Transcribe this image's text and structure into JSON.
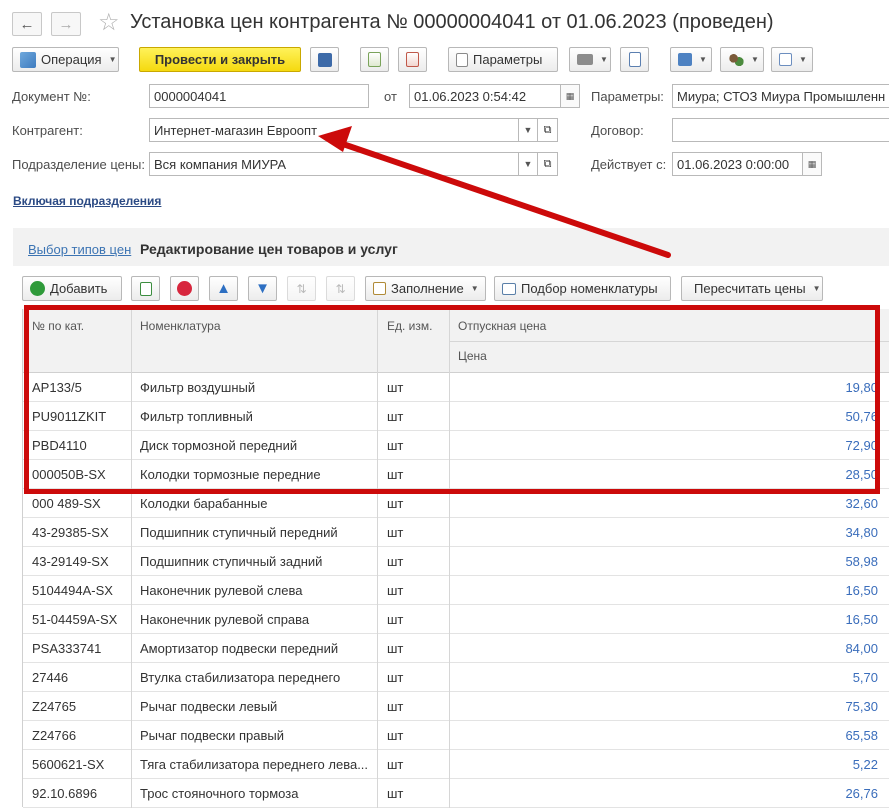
{
  "window": {
    "title": "Установка цен контрагента № 00000004041 от 01.06.2023 (проведен)"
  },
  "toolbar": {
    "operation_label": "Операция",
    "post_close_label": "Провести и закрыть",
    "params_label": "Параметры"
  },
  "form": {
    "doc_number_label": "Документ №:",
    "doc_number": "0000004041",
    "date_label": "от",
    "date": "01.06.2023  0:54:42",
    "params_label": "Параметры:",
    "params_value": "Миура; СТОЗ Миура Промышленный",
    "counterparty_label": "Контрагент:",
    "counterparty": "Интернет-магазин Евроопт",
    "contract_label": "Договор:",
    "contract": "",
    "division_label": "Подразделение цены:",
    "division": "Вся компания МИУРА",
    "valid_from_label": "Действует с:",
    "valid_from": "01.06.2023  0:00:00",
    "include_divisions_link": "Включая подразделения"
  },
  "tabs": {
    "price_types": "Выбор типов цен",
    "edit_prices": "Редактирование цен товаров и услуг"
  },
  "table_toolbar": {
    "add_label": "Добавить",
    "fill_label": "Заполнение",
    "pick_label": "Подбор номенклатуры",
    "recalc_label": "Пересчитать цены"
  },
  "table": {
    "headers": {
      "code": "№ по кат.",
      "name": "Номенклатура",
      "unit": "Ед. изм.",
      "group": "Отпускная цена",
      "price": "Цена"
    },
    "rows": [
      {
        "code": "AP133/5",
        "name": "Фильтр воздушный",
        "unit": "шт",
        "price": "19,80"
      },
      {
        "code": "PU9011ZKIT",
        "name": "Фильтр топливный",
        "unit": "шт",
        "price": "50,76"
      },
      {
        "code": "PBD4110",
        "name": "Диск тормозной передний",
        "unit": "шт",
        "price": "72,90"
      },
      {
        "code": "000050B-SX",
        "name": "Колодки тормозные передние",
        "unit": "шт",
        "price": "28,50"
      },
      {
        "code": "000 489-SX",
        "name": "Колодки барабанные",
        "unit": "шт",
        "price": "32,60"
      },
      {
        "code": "43-29385-SX",
        "name": "Подшипник ступичный передний",
        "unit": "шт",
        "price": "34,80"
      },
      {
        "code": "43-29149-SX",
        "name": "Подшипник ступичный задний",
        "unit": "шт",
        "price": "58,98"
      },
      {
        "code": "5104494A-SX",
        "name": "Наконечник рулевой слева",
        "unit": "шт",
        "price": "16,50"
      },
      {
        "code": "51-04459A-SX",
        "name": "Наконечник рулевой справа",
        "unit": "шт",
        "price": "16,50"
      },
      {
        "code": "PSA333741",
        "name": "Амортизатор подвески передний",
        "unit": "шт",
        "price": "84,00"
      },
      {
        "code": "27446",
        "name": "Втулка стабилизатора переднего",
        "unit": "шт",
        "price": "5,70"
      },
      {
        "code": "Z24765",
        "name": "Рычаг подвески левый",
        "unit": "шт",
        "price": "75,30"
      },
      {
        "code": "Z24766",
        "name": "Рычаг подвески правый",
        "unit": "шт",
        "price": "65,58"
      },
      {
        "code": "5600621-SX",
        "name": "Тяга стабилизатора переднего лева...",
        "unit": "шт",
        "price": "5,22"
      },
      {
        "code": "92.10.6896",
        "name": "Трос стояночного тормоза",
        "unit": "шт",
        "price": "26,76"
      }
    ]
  },
  "colors": {
    "accent_yellow": "#f5d90f",
    "link_blue": "#3c74b3",
    "price_blue": "#3a6dbb",
    "annotation_red": "#cc0a0a"
  }
}
